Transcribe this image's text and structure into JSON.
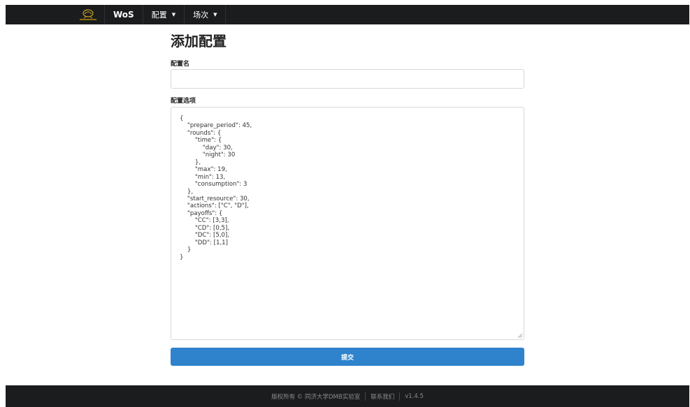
{
  "navbar": {
    "brand": "WoS",
    "menus": [
      {
        "label": "配置"
      },
      {
        "label": "场次"
      }
    ]
  },
  "form": {
    "title": "添加配置",
    "name_label": "配置名",
    "name_value": "",
    "options_label": "配置选项",
    "options_value": "{\n    \"prepare_period\": 45,\n    \"rounds\": {\n        \"time\": {\n            \"day\": 30,\n            \"night\": 30\n        },\n        \"max\": 19,\n        \"min\": 13,\n        \"consumption\": 3\n    },\n    \"start_resource\": 30,\n    \"actions\": [\"C\", \"D\"],\n    \"payoffs\": {\n        \"CC\": [3,3],\n        \"CD\": [0,5],\n        \"DC\": [5,0],\n        \"DD\": [1,1]\n    }\n}",
    "submit_label": "提交"
  },
  "footer": {
    "copyright": "版权所有 © 同济大学DMB实验室",
    "contact": "联系我们",
    "version": "v1.4.5"
  },
  "colors": {
    "navbar_bg": "#1b1c1d",
    "primary_button": "#2e83cc",
    "footer_text": "#8b8c8d"
  }
}
